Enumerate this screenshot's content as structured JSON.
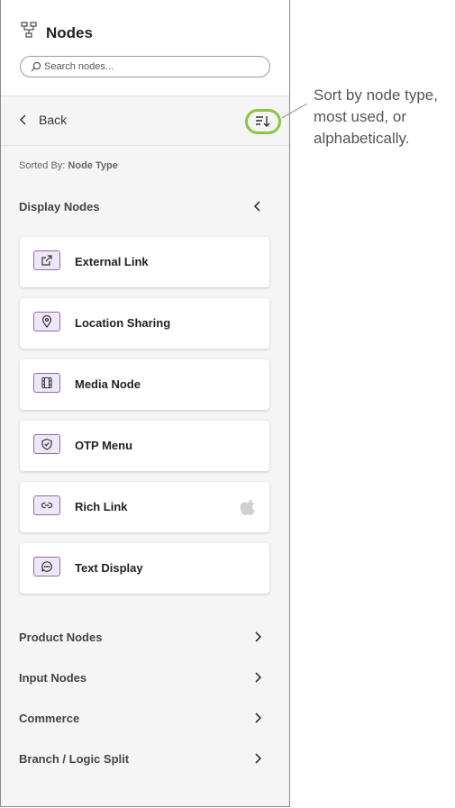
{
  "panel": {
    "title": "Nodes",
    "search_placeholder": "Search nodes...",
    "back_label": "Back",
    "sorted_by_label": "Sorted By:",
    "sorted_by_value": "Node Type"
  },
  "display_nodes": {
    "label": "Display Nodes",
    "items": [
      {
        "label": "External Link",
        "icon": "external-link-icon"
      },
      {
        "label": "Location Sharing",
        "icon": "map-pin-icon"
      },
      {
        "label": "Media Node",
        "icon": "film-icon"
      },
      {
        "label": "OTP Menu",
        "icon": "shield-check-icon"
      },
      {
        "label": "Rich Link",
        "icon": "link-icon",
        "badge": "apple-icon"
      },
      {
        "label": "Text Display",
        "icon": "chat-bubble-icon"
      }
    ]
  },
  "collapsed_sections": [
    {
      "label": "Product Nodes"
    },
    {
      "label": "Input Nodes"
    },
    {
      "label": "Commerce"
    },
    {
      "label": "Branch / Logic Split"
    }
  ],
  "annotation": {
    "text": "Sort by node type, most used, or alphabetically."
  },
  "colors": {
    "highlight_ring": "#8cc63e",
    "icon_tile_bg": "#efe6f7",
    "icon_tile_border": "#8e6bb0"
  }
}
